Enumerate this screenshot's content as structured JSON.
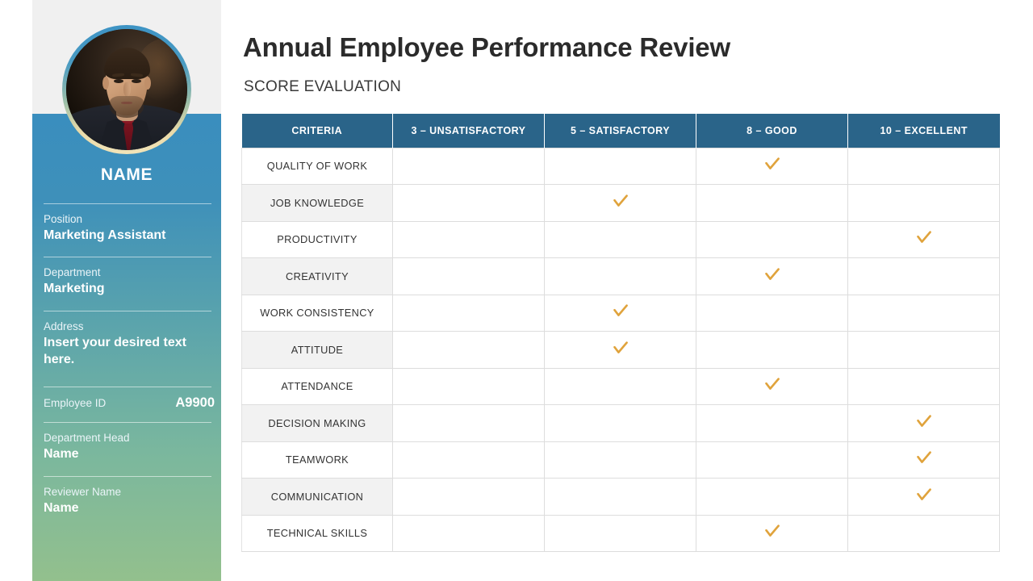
{
  "header": {
    "title": "Annual Employee Performance Review",
    "subtitle": "SCORE EVALUATION"
  },
  "sidebar": {
    "avatar_alt": "employee-photo",
    "name": "NAME",
    "fields": [
      {
        "label": "Position",
        "value": "Marketing Assistant"
      },
      {
        "label": "Department",
        "value": "Marketing"
      },
      {
        "label": "Address",
        "value": "Insert your desired text here."
      },
      {
        "label": "Employee ID",
        "value": "A9900",
        "inline": true
      },
      {
        "label": "Department Head",
        "value": "Name"
      },
      {
        "label": "Reviewer Name",
        "value": "Name"
      }
    ]
  },
  "colors": {
    "table_header_blue": "#2A6489",
    "checkmark_gold": "#E0A33C",
    "sidebar_top": "#3A8EBE",
    "sidebar_bottom": "#93C08D",
    "row_alt_gray": "#F2F2F2",
    "top_band_gray": "#F0F0F0"
  },
  "table": {
    "columns": [
      "CRITERIA",
      "3 – UNSATISFACTORY",
      "5 – SATISFACTORY",
      "8 – GOOD",
      "10 – EXCELLENT"
    ],
    "check_icon": "checkmark-icon",
    "rows": [
      {
        "criteria": "QUALITY OF WORK",
        "score": 8
      },
      {
        "criteria": "JOB KNOWLEDGE",
        "score": 5
      },
      {
        "criteria": "PRODUCTIVITY",
        "score": 10
      },
      {
        "criteria": "CREATIVITY",
        "score": 8
      },
      {
        "criteria": "WORK CONSISTENCY",
        "score": 5
      },
      {
        "criteria": "ATTITUDE",
        "score": 5
      },
      {
        "criteria": "ATTENDANCE",
        "score": 8
      },
      {
        "criteria": "DECISION MAKING",
        "score": 10
      },
      {
        "criteria": "TEAMWORK",
        "score": 10
      },
      {
        "criteria": "COMMUNICATION",
        "score": 10
      },
      {
        "criteria": "TECHNICAL SKILLS",
        "score": 8
      }
    ],
    "score_values": [
      3,
      5,
      8,
      10
    ]
  }
}
